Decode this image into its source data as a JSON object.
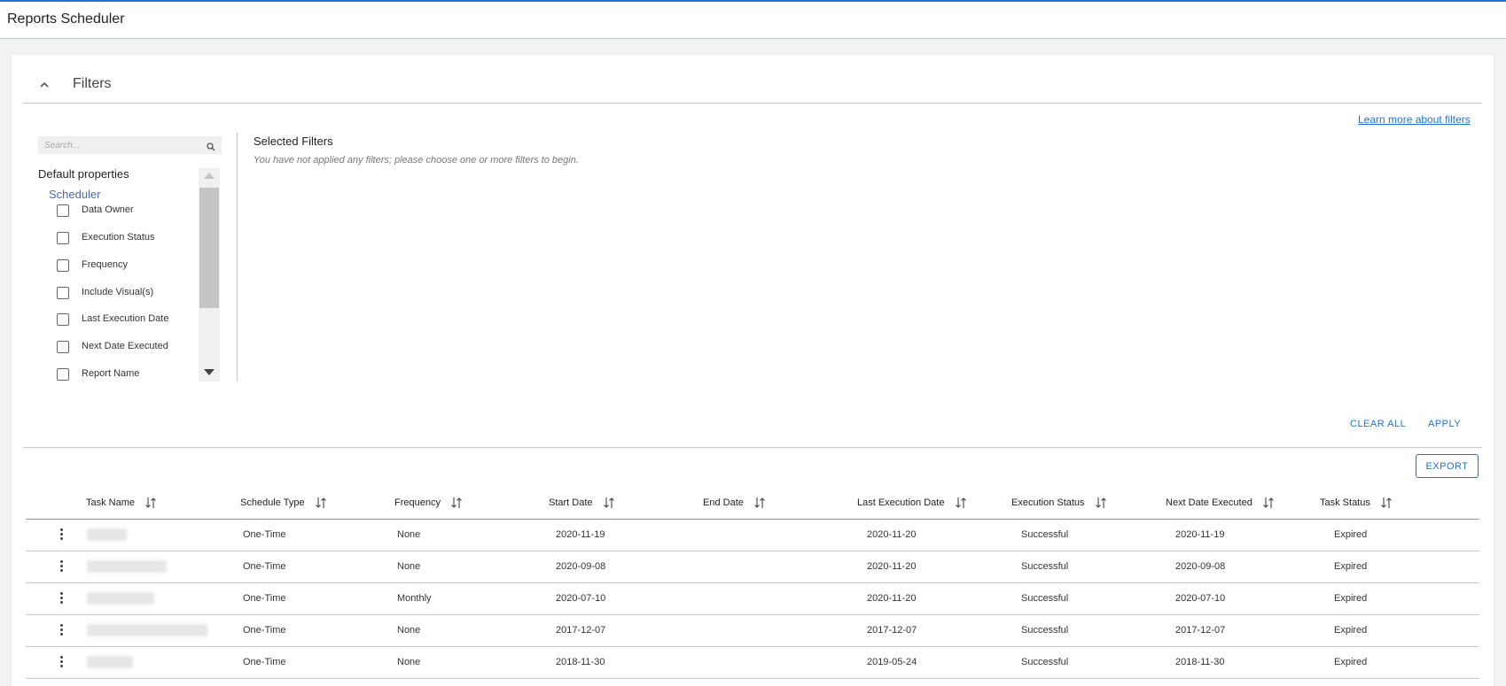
{
  "app": {
    "title": "Reports Scheduler"
  },
  "filters": {
    "title": "Filters",
    "learn_more": "Learn more about filters",
    "search_placeholder": "Search...",
    "default_properties_label": "Default properties",
    "group_label": "Scheduler",
    "properties": [
      "Data Owner",
      "Execution Status",
      "Frequency",
      "Include Visual(s)",
      "Last Execution Date",
      "Next Date Executed",
      "Report Name"
    ],
    "selected_title": "Selected Filters",
    "selected_empty": "You have not applied any filters; please choose one or more filters to begin.",
    "clear_all": "CLEAR ALL",
    "apply": "APPLY"
  },
  "table": {
    "export_label": "EXPORT",
    "columns": [
      "Task Name",
      "Schedule Type",
      "Frequency",
      "Start Date",
      "End Date",
      "Last Execution Date",
      "Execution Status",
      "Next Date Executed",
      "Task Status"
    ],
    "rows": [
      {
        "schedule_type": "One-Time",
        "frequency": "None",
        "start_date": "2020-11-19",
        "end_date": "",
        "last_execution": "2020-11-20",
        "execution_status": "Successful",
        "next_date": "2020-11-19",
        "task_status": "Expired"
      },
      {
        "schedule_type": "One-Time",
        "frequency": "None",
        "start_date": "2020-09-08",
        "end_date": "",
        "last_execution": "2020-11-20",
        "execution_status": "Successful",
        "next_date": "2020-09-08",
        "task_status": "Expired"
      },
      {
        "schedule_type": "One-Time",
        "frequency": "Monthly",
        "start_date": "2020-07-10",
        "end_date": "",
        "last_execution": "2020-11-20",
        "execution_status": "Successful",
        "next_date": "2020-07-10",
        "task_status": "Expired"
      },
      {
        "schedule_type": "One-Time",
        "frequency": "None",
        "start_date": "2017-12-07",
        "end_date": "",
        "last_execution": "2017-12-07",
        "execution_status": "Successful",
        "next_date": "2017-12-07",
        "task_status": "Expired"
      },
      {
        "schedule_type": "One-Time",
        "frequency": "None",
        "start_date": "2018-11-30",
        "end_date": "",
        "last_execution": "2019-05-24",
        "execution_status": "Successful",
        "next_date": "2018-11-30",
        "task_status": "Expired"
      }
    ]
  },
  "colors": {
    "accent": "#1f73d0",
    "divider": "#c8c8c8",
    "group_label": "#4a6aa5"
  },
  "icons": {
    "collapse": "chevron-up-icon",
    "search": "search-icon",
    "sort": "sort-icon",
    "row_menu": "kebab-menu-icon"
  }
}
